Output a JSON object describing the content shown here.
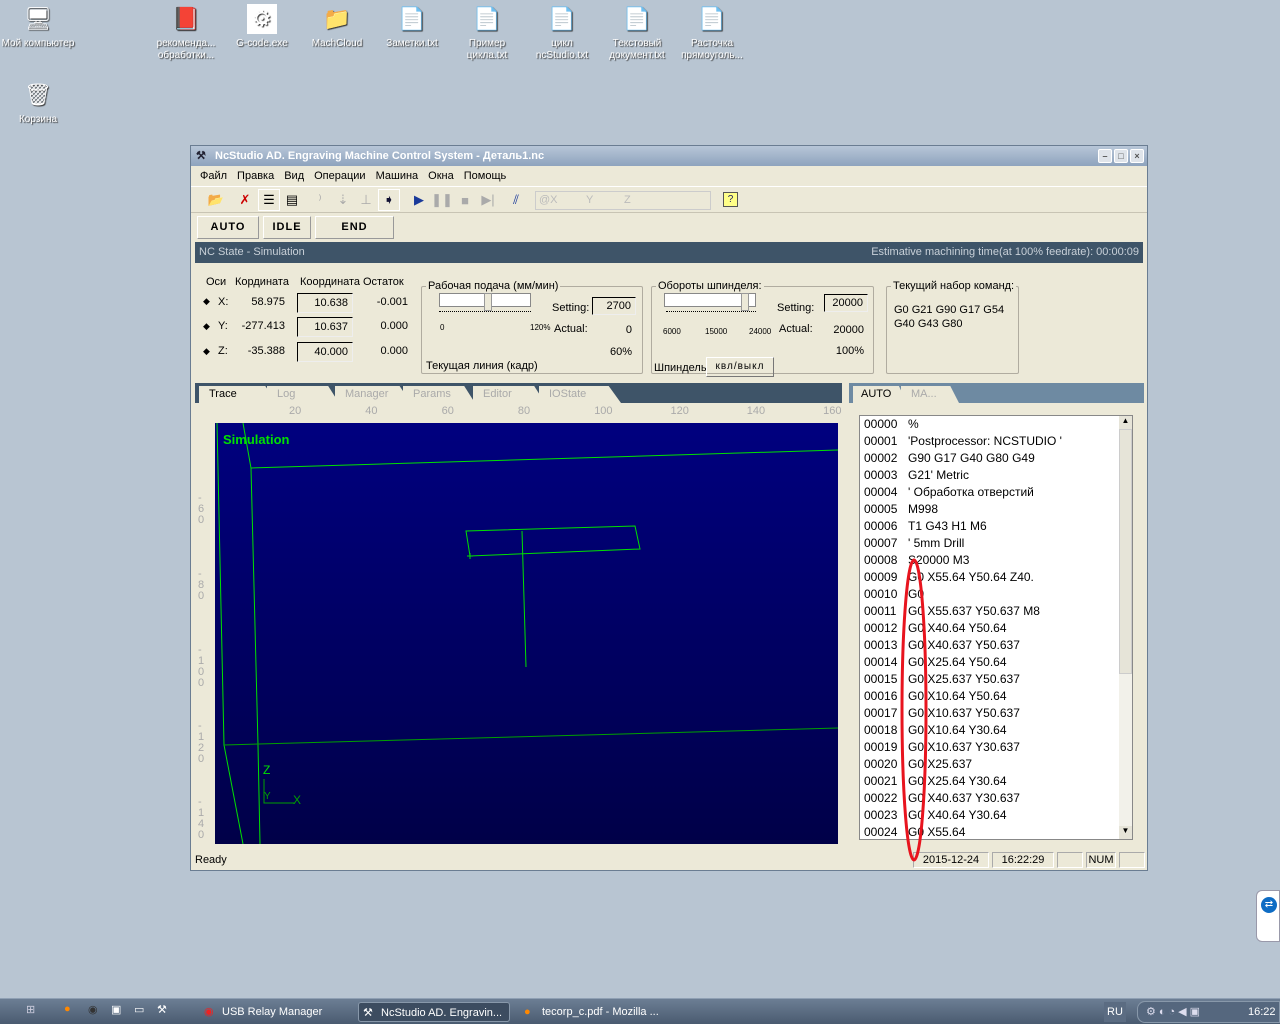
{
  "desktop": {
    "icons": [
      {
        "label": "Мой компьютер",
        "icon": "computer-icon"
      },
      {
        "label": "рекоменда... обработки...",
        "icon": "document-icon"
      },
      {
        "label": "G-code.exe",
        "icon": "app-icon"
      },
      {
        "label": "MachCloud",
        "icon": "folder-icon"
      },
      {
        "label": "Заметки.txt",
        "icon": "text-file-icon"
      },
      {
        "label": "Пример цикла.txt",
        "icon": "text-file-icon"
      },
      {
        "label": "цикл ncStudio.txt",
        "icon": "text-file-icon"
      },
      {
        "label": "Текстовый документ.txt",
        "icon": "text-file-icon"
      },
      {
        "label": "Расточка прямоуголь...",
        "icon": "text-file-icon"
      },
      {
        "label": "Корзина",
        "icon": "recycle-bin-icon"
      }
    ]
  },
  "window": {
    "title": "NcStudio AD. Engraving Machine Control System  - Деталь1.nc"
  },
  "menu": [
    "Файл",
    "Правка",
    "Вид",
    "Операции",
    "Машина",
    "Окна",
    "Помощь"
  ],
  "toolbar": {
    "coord_field": {
      "at": "@X",
      "y": "Y",
      "z": "Z"
    }
  },
  "state_buttons": [
    "AUTO",
    "IDLE",
    "END"
  ],
  "nc_state": {
    "left": "NC State - Simulation",
    "right": "Estimative machining time(at 100% feedrate): 00:00:09"
  },
  "axes": {
    "headers": [
      "Оси",
      "Кордината",
      "Координата",
      "Остаток"
    ],
    "rows": [
      {
        "axis": "X:",
        "machine": "58.975",
        "work": "10.638",
        "remain": "-0.001"
      },
      {
        "axis": "Y:",
        "machine": "-277.413",
        "work": "10.637",
        "remain": "0.000"
      },
      {
        "axis": "Z:",
        "machine": "-35.388",
        "work": "40.000",
        "remain": "0.000"
      }
    ]
  },
  "feed": {
    "legend": "Рабочая подача (мм/мин)",
    "setting_label": "Setting:",
    "setting": "2700",
    "actual_label": "Actual:",
    "actual": "0",
    "percent": "60%",
    "min": "0",
    "max": "120%",
    "slider_value_percent": 60,
    "current_line": "Текущая линия (кадр)"
  },
  "spindle": {
    "legend": "Обороты шпинделя:",
    "setting_label": "Setting:",
    "setting": "20000",
    "actual_label": "Actual:",
    "actual": "20000",
    "percent": "100%",
    "ticks": [
      "6000",
      "15000",
      "24000"
    ],
    "slider_value": 20000,
    "label": "Шпиндель",
    "toggle": "квл/выкл"
  },
  "commands": {
    "legend": "Текущий набор команд:",
    "line1": "G0 G21 G90 G17 G54",
    "line2": "G40 G43 G80"
  },
  "tabs": [
    "Trace",
    "Log",
    "Manager",
    "Params",
    "Editor",
    "IOState"
  ],
  "ruler": {
    "x": [
      "20",
      "40",
      "60",
      "80",
      "100",
      "120",
      "140",
      "160"
    ],
    "y": [
      "-60",
      "-80",
      "-100",
      "-120",
      "-140"
    ]
  },
  "sim": {
    "label": "Simulation",
    "axis_z": "Z",
    "axis_x": "X",
    "axis_y": "Y"
  },
  "right_tabs": [
    "AUTO",
    "MA..."
  ],
  "code": [
    [
      "00000",
      "%"
    ],
    [
      "00001",
      "'Postprocessor: NCSTUDIO '"
    ],
    [
      "00002",
      "G90 G17 G40 G80 G49"
    ],
    [
      "00003",
      "G21' Metric"
    ],
    [
      "00004",
      "' Обработка отверстий"
    ],
    [
      "00005",
      "M998"
    ],
    [
      "00006",
      "T1 G43 H1 M6"
    ],
    [
      "00007",
      "' 5mm Drill"
    ],
    [
      "00008",
      "S20000 M3"
    ],
    [
      "00009",
      "G0 X55.64 Y50.64 Z40."
    ],
    [
      "00010",
      "G0"
    ],
    [
      "00011",
      "G0 X55.637 Y50.637 M8"
    ],
    [
      "00012",
      "G0 X40.64 Y50.64"
    ],
    [
      "00013",
      "G0 X40.637 Y50.637"
    ],
    [
      "00014",
      "G0 X25.64 Y50.64"
    ],
    [
      "00015",
      "G0 X25.637 Y50.637"
    ],
    [
      "00016",
      "G0 X10.64 Y50.64"
    ],
    [
      "00017",
      "G0 X10.637 Y50.637"
    ],
    [
      "00018",
      "G0 X10.64 Y30.64"
    ],
    [
      "00019",
      "G0 X10.637 Y30.637"
    ],
    [
      "00020",
      "G0 X25.637"
    ],
    [
      "00021",
      "G0 X25.64 Y30.64"
    ],
    [
      "00022",
      "G0 X40.637 Y30.637"
    ],
    [
      "00023",
      "G0 X40.64 Y30.64"
    ],
    [
      "00024",
      "G0 X55.64"
    ]
  ],
  "status": {
    "ready": "Ready",
    "date": "2015-12-24",
    "time": "16:22:29",
    "num": "NUM"
  },
  "taskbar": {
    "items": [
      "USB Relay Manager",
      "NcStudio AD. Engravin...",
      "tecorp_c.pdf - Mozilla ..."
    ],
    "lang": "RU",
    "clock": "16:22"
  },
  "colors": {
    "desktop": "#b8c5d2",
    "panel": "#ece9d8",
    "ncbar": "#3e5468",
    "sim_bg": "#00007f",
    "trace": "#00e000",
    "annotation": "#e8141e"
  }
}
